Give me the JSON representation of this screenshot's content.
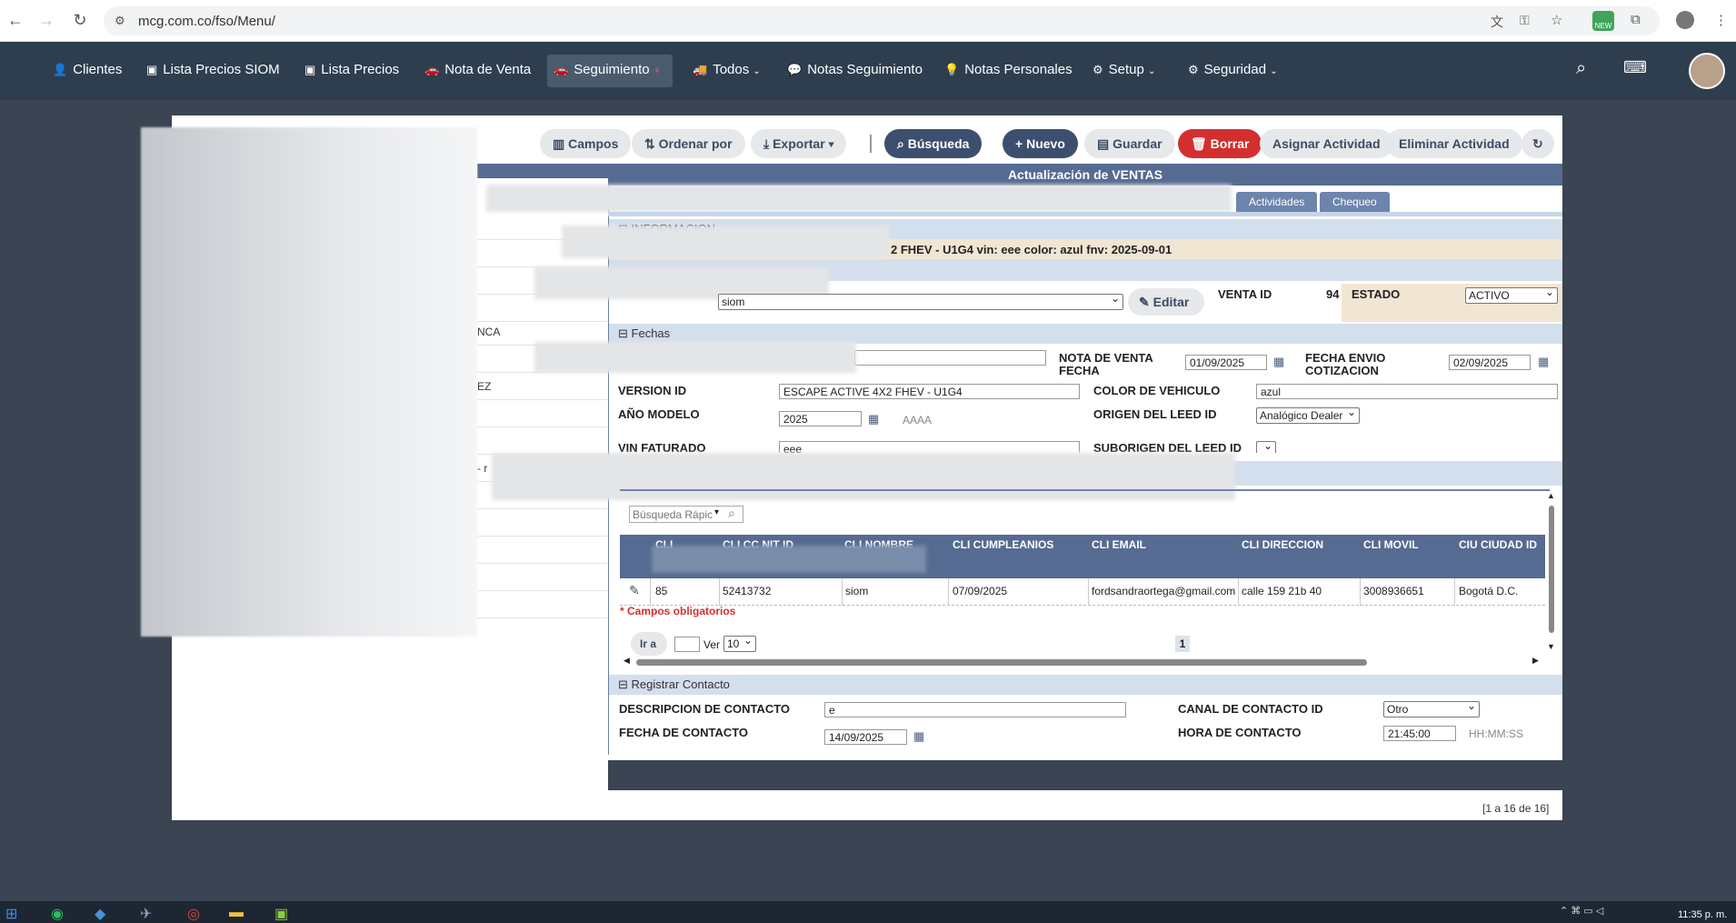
{
  "browser": {
    "url": "mcg.com.co/fso/Menu/"
  },
  "nav": {
    "items": [
      {
        "label": "Clientes",
        "icon": "user-icon"
      },
      {
        "label": "Lista Precios SIOM",
        "icon": "money-icon"
      },
      {
        "label": "Lista Precios",
        "icon": "money-icon"
      },
      {
        "label": "Nota de Venta",
        "icon": "car-icon"
      },
      {
        "label": "Seguimiento",
        "icon": "car-icon"
      },
      {
        "label": "Todos",
        "icon": "truck-icon"
      },
      {
        "label": "Notas Seguimiento",
        "icon": "comments-icon"
      },
      {
        "label": "Notas Personales",
        "icon": "lightbulb-icon"
      },
      {
        "label": "Setup",
        "icon": "cogs-icon"
      },
      {
        "label": "Seguridad",
        "icon": "gear-icon"
      }
    ]
  },
  "toolbar": {
    "campos": "Campos",
    "ordenar": "Ordenar por",
    "exportar": "Exportar",
    "busqueda": "Búsqueda",
    "nuevo": "Nuevo",
    "guardar": "Guardar",
    "borrar": "Borrar",
    "asignar": "Asignar Actividad",
    "eliminar": "Eliminar Actividad"
  },
  "left": {
    "rows": [
      "NCA",
      "EZ",
      "- r"
    ]
  },
  "form": {
    "title": "Actualización de VENTAS",
    "tabs": [
      "Actividades",
      "Chequeo"
    ],
    "info_section": "INFORMACION",
    "info_line": "2 FHEV - U1G4 vin: eee color: azul fnv: 2025-09-01",
    "cliente_select": "siom",
    "editar": "Editar",
    "venta_id_label": "VENTA ID",
    "venta_id": "94",
    "estado_label": "ESTADO",
    "estado": "ACTIVO",
    "fechas_section": "Fechas",
    "nota_fecha_label1": "NOTA DE VENTA",
    "nota_fecha_label2": "FECHA",
    "nota_fecha": "01/09/2025",
    "envio_label1": "FECHA ENVIO",
    "envio_label2": "COTIZACION",
    "envio": "02/09/2025",
    "version_label": "VERSION ID",
    "version": "ESCAPE ACTIVE 4X2 FHEV - U1G4",
    "color_label": "COLOR DE VEHICULO",
    "color": "azul",
    "anio_label": "AÑO MODELO",
    "anio": "2025",
    "anio_fmt": "AAAA",
    "origen_label": "ORIGEN DEL LEED ID",
    "origen": "Analógico Dealer",
    "vin_label": "VIN FATURADO",
    "vin": "eee",
    "suborigen_label": "SUBORIGEN DEL LEED ID",
    "busqueda_placeholder": "Búsqueda Rápic",
    "grid_headers": [
      "CLI",
      "CLI CC NIT ID",
      "CLI NOMBRE",
      "CLI CUMPLEANIOS",
      "CLI EMAIL",
      "CLI DIRECCION",
      "CLI MOVIL",
      "CIU CIUDAD ID"
    ],
    "grid_row": [
      "85",
      "52413732",
      "siom",
      "07/09/2025",
      "fordsandraortega@gmail.com",
      "calle 159 21b 40",
      "3008936651",
      "Bogotá D.C."
    ],
    "obligatorios": "* Campos obligatorios",
    "ir_a": "Ir a",
    "ver": "Ver",
    "ver_val": "10",
    "page": "1",
    "contacto_section": "Registrar Contacto",
    "desc_label": "DESCRIPCION DE CONTACTO",
    "desc": "e",
    "canal_label": "CANAL DE CONTACTO ID",
    "canal": "Otro",
    "fecha_contacto_label": "FECHA DE CONTACTO",
    "fecha_contacto": "14/09/2025",
    "hora_label": "HORA DE CONTACTO",
    "hora": "21:45:00",
    "hora_fmt": "HH:MM:SS"
  },
  "footer": "[1 a 16 de 16]",
  "taskbar": {
    "time": "11:35 p. m."
  }
}
